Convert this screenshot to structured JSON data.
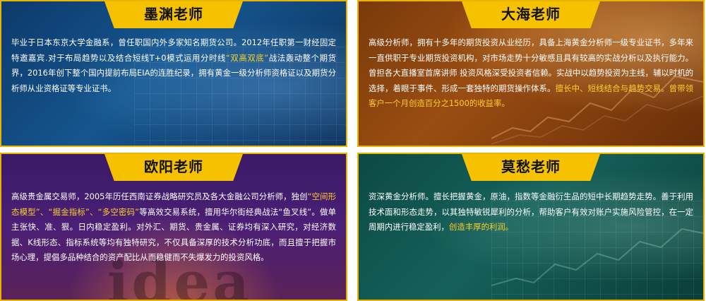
{
  "cards": [
    {
      "name": "墨渊老师",
      "segments": [
        {
          "t": "毕业于日本东京大学金融系，曾任职国内外多家知名期货公司。2012年任职第一财经固定特邀嘉宾.对于布局趋势以及结合短线T+0模式运用分时线",
          "hl": false
        },
        {
          "t": "“双高双底”",
          "hl": true
        },
        {
          "t": "战法轰动整个期货界，2016年创下整个国内提前布局EIA的连胜纪录，拥有黄金一级分析师资格证以及期货分析师从业资格证等专业证书。",
          "hl": false
        }
      ]
    },
    {
      "name": "大海老师",
      "segments": [
        {
          "t": "高级分析师，拥有十多年的期货投资从业经历，具备上海黄金分析师一级专业证书，多年来一直供职于专业期货投资机构，对市场走势十分敏感且具有较高的实战分析以及执行能力。曾担各大直播室首席讲师 投资风格深受投资者信赖。实战中以趋势投资为主线，辅以时机的选择，着眼于事件、形成一套独特的期货操作体系。",
          "hl": false
        },
        {
          "t": "擅长中、短线结合与趋势交易。曾带领客户一个月创造百分之1500的收益率。",
          "hl": true
        }
      ]
    },
    {
      "name": "欧阳老师",
      "segments": [
        {
          "t": "高级贵金属交易师，2005年历任西南证券战略研究员及各大金融公司分析师，独创",
          "hl": false
        },
        {
          "t": "“空间形态模型”、“掘金指标”、“多空密码”",
          "hl": true
        },
        {
          "t": "等高效交易系统，擅用华尔街经典战法“鱼叉线”。做单主张快、准、狠。日内稳定盈利。对外汇、期货、贵金属、证券均有深入研究，对经济数据、K线形态、指标系统等均有独特研究，不仅具备深厚的技术分析功底，而且擅于把握市场心理，提倡多品种结合的资产配比从而稳健而不失爆发力的投资风格。",
          "hl": false
        }
      ]
    },
    {
      "name": "莫愁老师",
      "segments": [
        {
          "t": "资深黄金分析师。擅长把握黄金，原油，指数等金融衍生品的短中长期趋势走势。善于利用技术面和形态走势，以其独特敏锐犀利的分析，帮助客户有效对账户实施风险管控，在一定周期内进行稳定盈利，",
          "hl": false
        },
        {
          "t": "创造丰厚的利润。",
          "hl": true
        }
      ]
    }
  ],
  "watermark": "idea",
  "colors": {
    "accent": "#f6c200",
    "highlight": "#ffd028"
  }
}
